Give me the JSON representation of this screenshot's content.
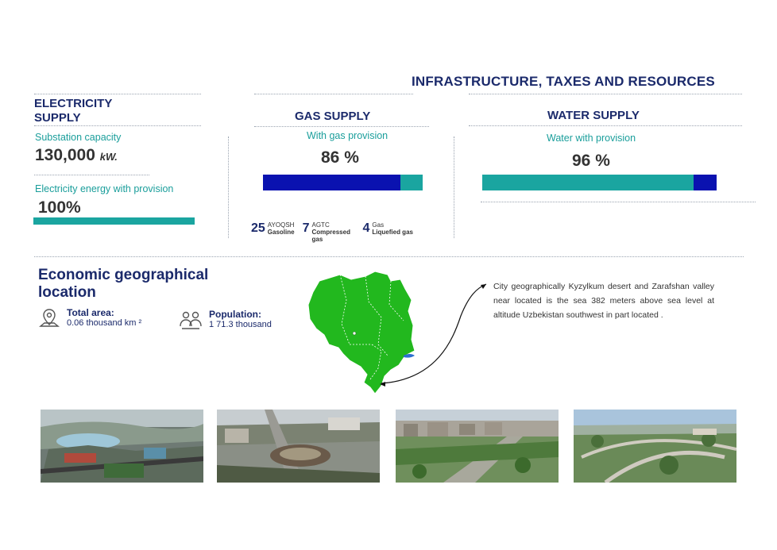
{
  "header": {
    "title": "INFRASTRUCTURE, TAXES AND RESOURCES"
  },
  "electricity": {
    "title_line1": "ELECTRICITY",
    "title_line2": "SUPPLY",
    "capacity_label": "Substation capacity",
    "capacity_value": "130,000",
    "capacity_unit": "kW.",
    "provision_label": "Electricity energy with provision",
    "provision_value": "100%",
    "provision_fraction": 1.0
  },
  "gas": {
    "title": "GAS SUPPLY",
    "provision_label": "With gas provision",
    "provision_value": "86 %",
    "provision_fraction": 0.86,
    "stations": [
      {
        "count": "25",
        "code": "AYOQSH",
        "name": "Gasoline"
      },
      {
        "count": "7",
        "code": "AGTC",
        "name": "Compressed gas"
      },
      {
        "count": "4",
        "code": "Gas",
        "name": "Liquefied gas"
      }
    ]
  },
  "water": {
    "title": "WATER SUPPLY",
    "provision_label": "Water with provision",
    "provision_value": "96 %",
    "provision_fraction": 0.9
  },
  "economic": {
    "title": "Economic geographical location",
    "area_label": "Total area:",
    "area_value": "0.06 thousand km ²",
    "population_label": "Population:",
    "population_value": "1 71.3 thousand",
    "description": "City geographically Kyzylkum desert and Zarafshan valley near located is the sea 382 meters above sea level at altitude Uzbekistan southwest in part located ."
  },
  "colors": {
    "navy": "#1b2a6b",
    "teal": "#1a9e9b",
    "bar_navy": "#0a12b0",
    "bar_teal": "#1aa5a0",
    "map_green": "#22b81e"
  },
  "icons": [
    "location-pin-icon",
    "people-icon"
  ]
}
